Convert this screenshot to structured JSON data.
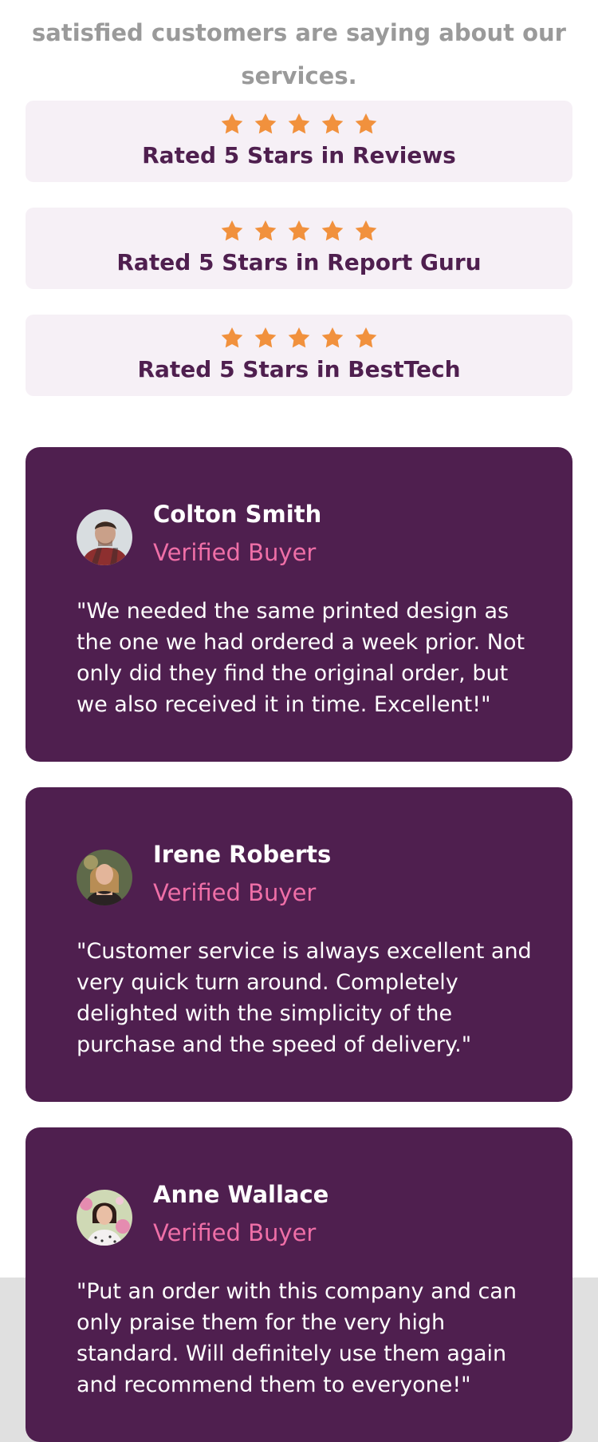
{
  "intro": {
    "text": "satisfied customers are saying about our services."
  },
  "ratings": [
    {
      "stars": 5,
      "title": "Rated 5 Stars in Reviews"
    },
    {
      "stars": 5,
      "title": "Rated 5 Stars in Report Guru"
    },
    {
      "stars": 5,
      "title": "Rated 5 Stars in BestTech"
    }
  ],
  "testimonials": [
    {
      "name": "Colton Smith",
      "role": "Verified Buyer",
      "quote": "\"We needed the same printed design as the one we had ordered a week prior. Not only did they find the original order, but we also received it in time. Excellent!\""
    },
    {
      "name": "Irene Roberts",
      "role": "Verified Buyer",
      "quote": "\"Customer service is always excellent and very quick turn around. Completely delighted with the simplicity of the purchase and the speed of delivery.\""
    },
    {
      "name": "Anne Wallace",
      "role": "Verified Buyer",
      "quote": "\"Put an order with this company and can only praise them for the very high standard. Will definitely use them again and recommend them to everyone!\""
    }
  ],
  "colors": {
    "accent_star": "#f1913d",
    "brand_purple": "#4f1f4f",
    "rating_card_bg": "#f6f0f6",
    "role_pink": "#ef6fa7",
    "intro_gray": "#9a9a9a"
  },
  "icons": {
    "rating_icon": "star-icon"
  }
}
